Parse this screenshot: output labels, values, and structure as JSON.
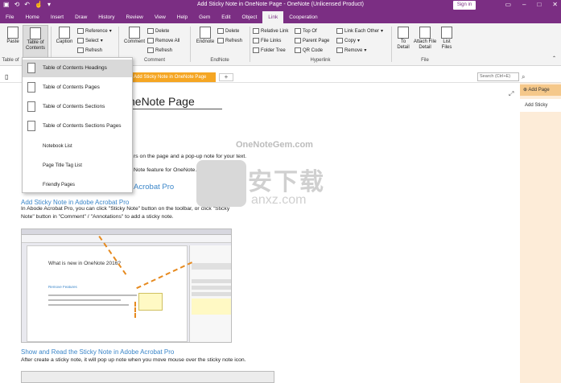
{
  "window": {
    "title": "Add Sticky Note in OneNote Page - OneNote (Unlicensed Product)",
    "signin": "Sign in"
  },
  "tabs": [
    "File",
    "Home",
    "Insert",
    "Draw",
    "History",
    "Review",
    "View",
    "Help",
    "Gem",
    "Edit",
    "Object",
    "Link",
    "Cooperation"
  ],
  "active_tab": "Link",
  "ribbon": {
    "paste": "Paste",
    "toc": "Table of Contents",
    "caption": "Caption",
    "reference": "Reference",
    "select": "Select",
    "refresh": "Refresh",
    "comment": "Comment",
    "delete": "Delete",
    "remove_all": "Remove All",
    "refresh2": "Refresh",
    "endnote": "Endnote",
    "delete2": "Delete",
    "refresh3": "Refresh",
    "relative_link": "Relative Link",
    "file_links": "File Links",
    "folder_tree": "Folder Tree",
    "top_of": "Top Of",
    "parent_page": "Parent Page",
    "qr_code": "QR Code",
    "link_each_other": "Link Each Other",
    "copy": "Copy",
    "remove": "Remove",
    "to_detail": "To Detail",
    "attach_file_detail": "Attach File Detail",
    "list_files": "List Files",
    "groups": {
      "table_of": "Table of",
      "comment": "Comment",
      "endnote": "EndNote",
      "hyperlink": "Hyperlink",
      "file": "File"
    }
  },
  "notebar": {
    "section_tab": "Add Sticky Note in OneNote Page",
    "add_tab": "+",
    "search_placeholder": "Search (Ctrl+E)"
  },
  "dropdown": {
    "items": [
      "Table of Contents Headings",
      "Table of Contents Pages",
      "Table of Contents Sections",
      "Table of Contents Sections Pages",
      "Notebook List",
      "Page Title Tag List",
      "Friendly Pages"
    ],
    "selected_index": 0
  },
  "page": {
    "title_fragment": "neNote Page",
    "line1": "rs on the page and a pop-up note for your text.",
    "line2": "Note feature for OneNote.",
    "heading_fragment": "Acrobat Pro",
    "heading2": "Add Sticky Note in Adobe Acrobat Pro",
    "p1": "In Abode Acrobat Pro, you can click \"Sticky Note\" button on the toolbar, or click \"Sticky",
    "p2": "Note\" button in \"Comment\" / \"Annotations\" to add a sticky note.",
    "heading3": "Show and Read the Sticky Note in Adobe Acrobat Pro",
    "p3": "After create a sticky note, it will pop up note when you move mouse over the sticky note icon.",
    "shot_title": "What is new in OneNote 2016?",
    "shot_link": "Remove Features"
  },
  "page_pane": {
    "add_page": "Add Page",
    "item": "Add Sticky"
  },
  "watermark": {
    "site": "OneNoteGem.com",
    "cn": "安下载",
    "url": "anxz.com"
  }
}
